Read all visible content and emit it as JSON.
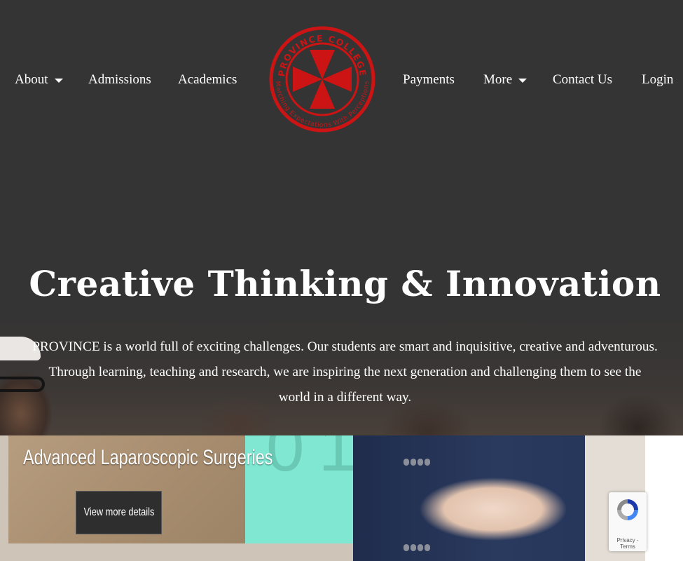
{
  "nav": {
    "left": [
      {
        "label": "About",
        "dropdown": true
      },
      {
        "label": "Admissions",
        "dropdown": false
      },
      {
        "label": "Academics",
        "dropdown": false
      }
    ],
    "right": [
      {
        "label": "Payments",
        "dropdown": false
      },
      {
        "label": "More",
        "dropdown": true
      },
      {
        "label": "Contact Us",
        "dropdown": false
      },
      {
        "label": "Login",
        "dropdown": false
      }
    ]
  },
  "logo": {
    "top_text": "PROVINCE COLLEGE",
    "bottom_text": "Marching Expectations With Perceptions",
    "color": "#cc1414"
  },
  "hero": {
    "title": "Creative Thinking & Innovation",
    "description": "PROVINCE is a world full of exciting challenges. Our students are smart and inquisitive, creative and adventurous. Through learning, teaching and research, we are inspiring the next generation and challenging them to see the world in a different way."
  },
  "banner": {
    "heading": "Advanced Laparoscopic Surgeries",
    "button_label": "View more details",
    "digits": "01"
  },
  "recaptcha": {
    "links": "Privacy - Terms"
  },
  "colors": {
    "hero_bg": "#343434",
    "text": "#ffffff",
    "logo_red": "#cc1414",
    "teal": "#7fe7d2"
  }
}
